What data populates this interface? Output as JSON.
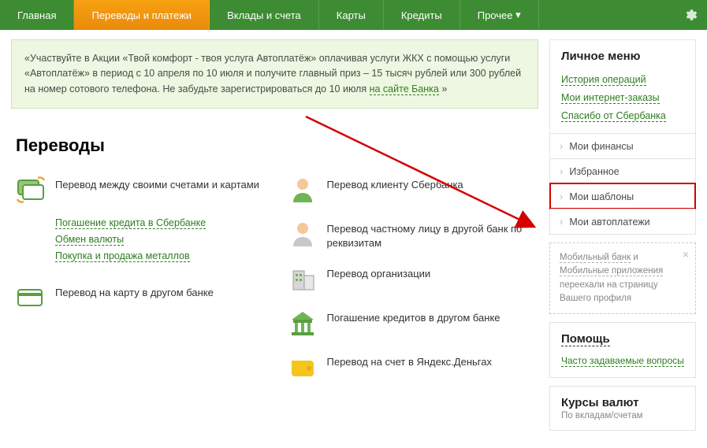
{
  "nav": {
    "home": "Главная",
    "transfers": "Переводы и платежи",
    "deposits": "Вклады и счета",
    "cards": "Карты",
    "credits": "Кредиты",
    "other": "Прочее"
  },
  "banner": {
    "text1": "«Участвуйте в Акции «Твой комфорт - твоя услуга Автоплатёж» оплачивая услуги ЖКХ с помощью услуги «Автоплатёж» в период с 10 апреля по 10 июля и получите главный приз – 15 тысяч рублей или 300 рублей на номер сотового телефона. Не забудьте зарегистрироваться до 10 июля ",
    "link": "на сайте Банка",
    "text2": " »"
  },
  "section_title": "Переводы",
  "tiles_left": {
    "t1": "Перевод между своими счетами и картами",
    "sub1": "Погашение кредита в Сбербанке",
    "sub2": "Обмен валюты",
    "sub3": "Покупка и продажа металлов",
    "t2": "Перевод на карту в другом банке"
  },
  "tiles_right": {
    "t1": "Перевод клиенту Сбербанка",
    "t2": "Перевод частному лицу в другой банк по реквизитам",
    "t3": "Перевод организации",
    "t4": "Погашение кредитов в другом банке",
    "t5": "Перевод на счет в Яндекс.Деньгах"
  },
  "sidebar": {
    "title": "Личное меню",
    "history": "История операций",
    "orders": "Мои интернет-заказы",
    "thanks": "Спасибо от Сбербанка",
    "menu": {
      "finances": "Мои финансы",
      "fav": "Избранное",
      "templates": "Мои шаблоны",
      "autopay": "Мои автоплатежи"
    },
    "notice_a1": "Мобильный банк",
    "notice_sep": " и ",
    "notice_a2": "Мобильные приложения",
    "notice_tail": " переехали на страницу Вашего профиля",
    "help_title": "Помощь",
    "faq": "Часто задаваемые вопросы",
    "rates_title": "Курсы валют",
    "rates_sub": "По вкладам/счетам"
  }
}
